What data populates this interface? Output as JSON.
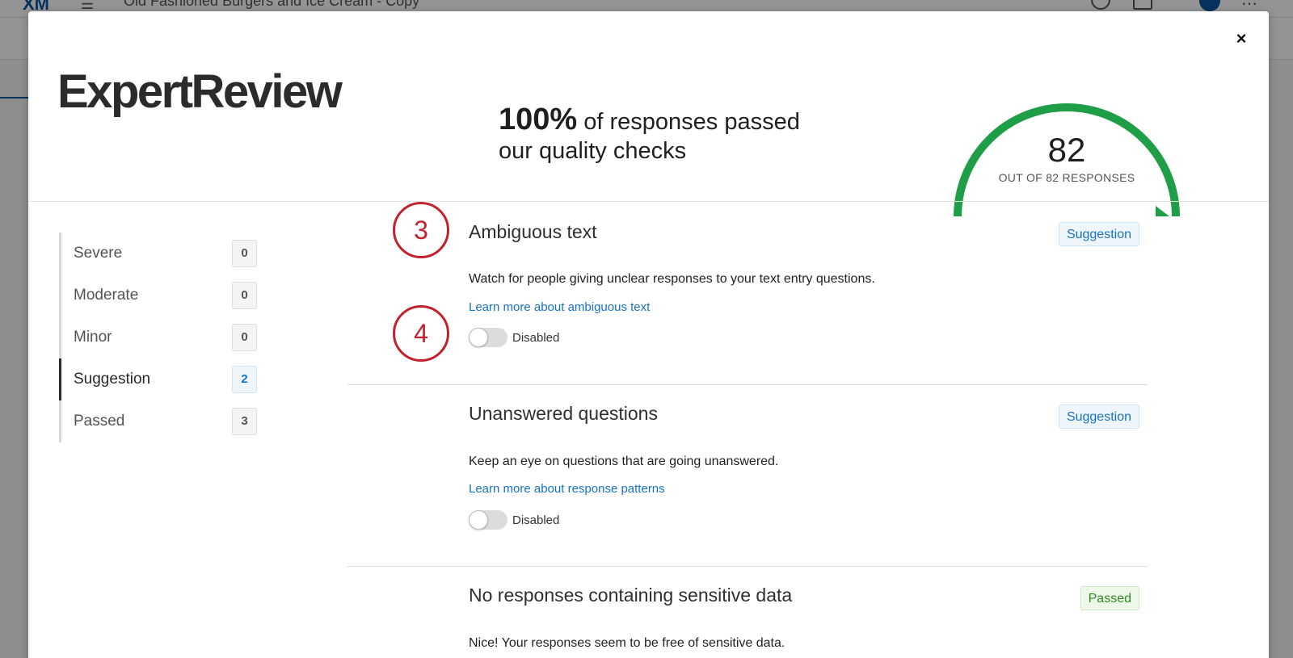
{
  "background": {
    "logo": "XM",
    "survey_title": "Old Fashioned Burgers and Ice Cream - Copy"
  },
  "modal": {
    "logo": "ExpertReview",
    "close_label": "×",
    "summary": {
      "percent": "100%",
      "text_line1": " of responses passed",
      "text_line2": "our quality checks"
    },
    "gauge": {
      "value": "82",
      "subtitle": "OUT OF 82 RESPONSES",
      "fraction_passed": 1.0,
      "color": "#1f9e48"
    },
    "sidebar": {
      "items": [
        {
          "label": "Severe",
          "count": "0"
        },
        {
          "label": "Moderate",
          "count": "0"
        },
        {
          "label": "Minor",
          "count": "0"
        },
        {
          "label": "Suggestion",
          "count": "2"
        },
        {
          "label": "Passed",
          "count": "3"
        }
      ]
    },
    "checks": [
      {
        "title": "Ambiguous text",
        "badge": "Suggestion",
        "description": "Watch for people giving unclear responses to your text entry questions.",
        "link": "Learn more about ambiguous text",
        "toggle_label": "Disabled"
      },
      {
        "title": "Unanswered questions",
        "badge": "Suggestion",
        "description": "Keep an eye on questions that are going unanswered.",
        "link": "Learn more about response patterns",
        "toggle_label": "Disabled"
      },
      {
        "title": "No responses containing sensitive data",
        "badge": "Passed",
        "description": "Nice! Your responses seem to be free of sensitive data."
      }
    ],
    "annotations": [
      "3",
      "4"
    ]
  },
  "colors": {
    "accent": "#1673c4",
    "annotation": "#c2212e",
    "passed": "#2c8b1c"
  }
}
